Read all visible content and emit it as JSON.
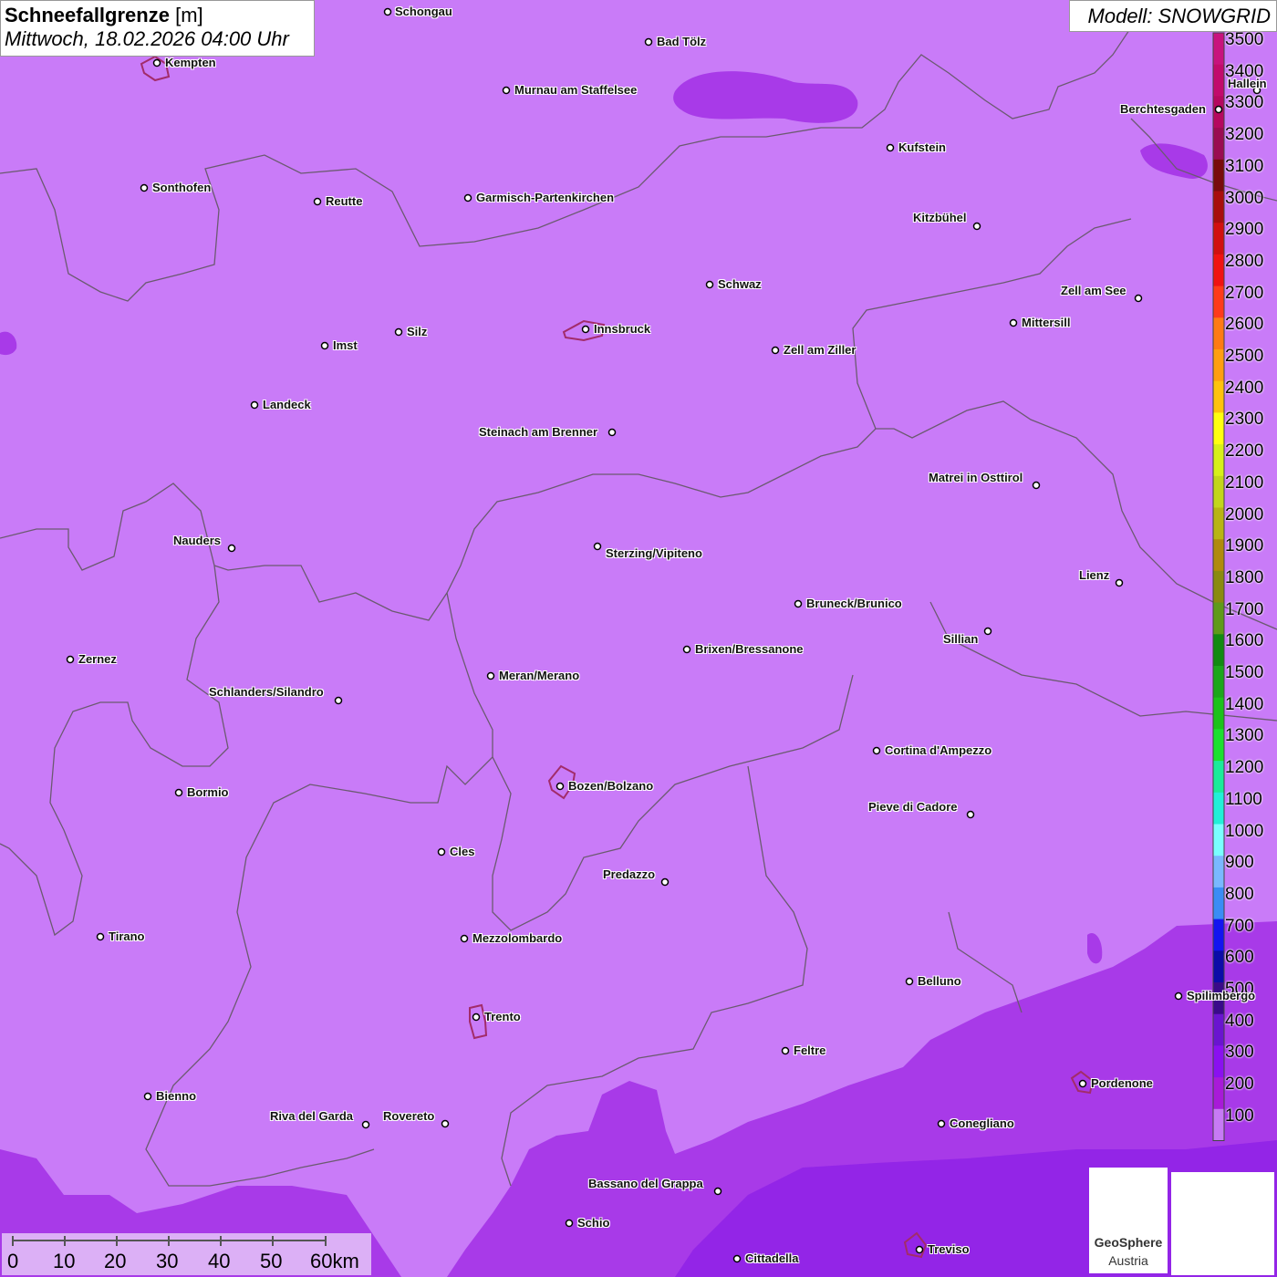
{
  "header": {
    "title_bold": "Schneefallgrenze",
    "title_unit": "[m]",
    "datetime": "Mittwoch, 18.02.2026 04:00 Uhr",
    "model": "Modell: SNOWGRID"
  },
  "legend": {
    "values": [
      "3500",
      "3400",
      "3300",
      "3200",
      "3100",
      "3000",
      "2900",
      "2800",
      "2700",
      "2600",
      "2500",
      "2400",
      "2300",
      "2200",
      "2100",
      "2000",
      "1900",
      "1800",
      "1700",
      "1600",
      "1500",
      "1400",
      "1300",
      "1200",
      "1100",
      "1000",
      "900",
      "800",
      "700",
      "600",
      "500",
      "400",
      "300",
      "200",
      "100"
    ],
    "colors": [
      "#c8127e",
      "#c20a6c",
      "#b5085f",
      "#9a0c52",
      "#780b0b",
      "#a80d0d",
      "#d10f0f",
      "#f01212",
      "#ff3a1a",
      "#ff7a14",
      "#ff9e10",
      "#ffc20c",
      "#ffff10",
      "#d6f01a",
      "#c2d61c",
      "#b8b414",
      "#b08a0c",
      "#8a8a10",
      "#5f9a1a",
      "#128a12",
      "#1ca61c",
      "#1cc21c",
      "#1ce030",
      "#1aeb9a",
      "#22f0d8",
      "#7affff",
      "#7ab8ff",
      "#3a8cf5",
      "#1414f0",
      "#0c0ca8",
      "#3a0a8a",
      "#6a14d0",
      "#8a10f0",
      "#a81ad8",
      "#c77af5"
    ]
  },
  "cities": [
    "Schongau",
    "Bad Tölz",
    "Kempten",
    "Murnau am Staffelsee",
    "Kufstein",
    "Berchtesgaden",
    "Sonthofen",
    "Reutte",
    "Garmisch-Partenkirchen",
    "Kitzbühel",
    "Schwaz",
    "Zell am See",
    "Innsbruck",
    "Mittersill",
    "Imst",
    "Silz",
    "Zell am Ziller",
    "Landeck",
    "Steinach am Brenner",
    "Matrei in Osttirol",
    "Nauders",
    "Sterzing/Vipiteno",
    "Lienz",
    "Bruneck/Brunico",
    "Sillian",
    "Zernez",
    "Brixen/Bressanone",
    "Meran/Merano",
    "Schlanders/Silandro",
    "Cortina d'Ampezzo",
    "Bozen/Bolzano",
    "Bormio",
    "Pieve di Cadore",
    "Cles",
    "Predazzo",
    "Tirano",
    "Mezzolombardo",
    "Belluno",
    "Spilimbergo",
    "Trento",
    "Feltre",
    "Pordenone",
    "Bienno",
    "Riva del Garda",
    "Rovereto",
    "Conegliano",
    "Bassano del Grappa",
    "Schio",
    "Treviso",
    "Cittadella",
    "Hallein"
  ],
  "scale": {
    "labels": [
      "0",
      "10",
      "20",
      "30",
      "40",
      "50",
      "60km"
    ]
  },
  "logos": {
    "geosphere_line1": "GeoSphere",
    "geosphere_line2": "Austria"
  },
  "colors": {
    "base_snowline": "#c97bf8",
    "low_snowline": "#a83ae8",
    "lowest_snowline": "#8f22e6",
    "border": "#6b5a70"
  }
}
